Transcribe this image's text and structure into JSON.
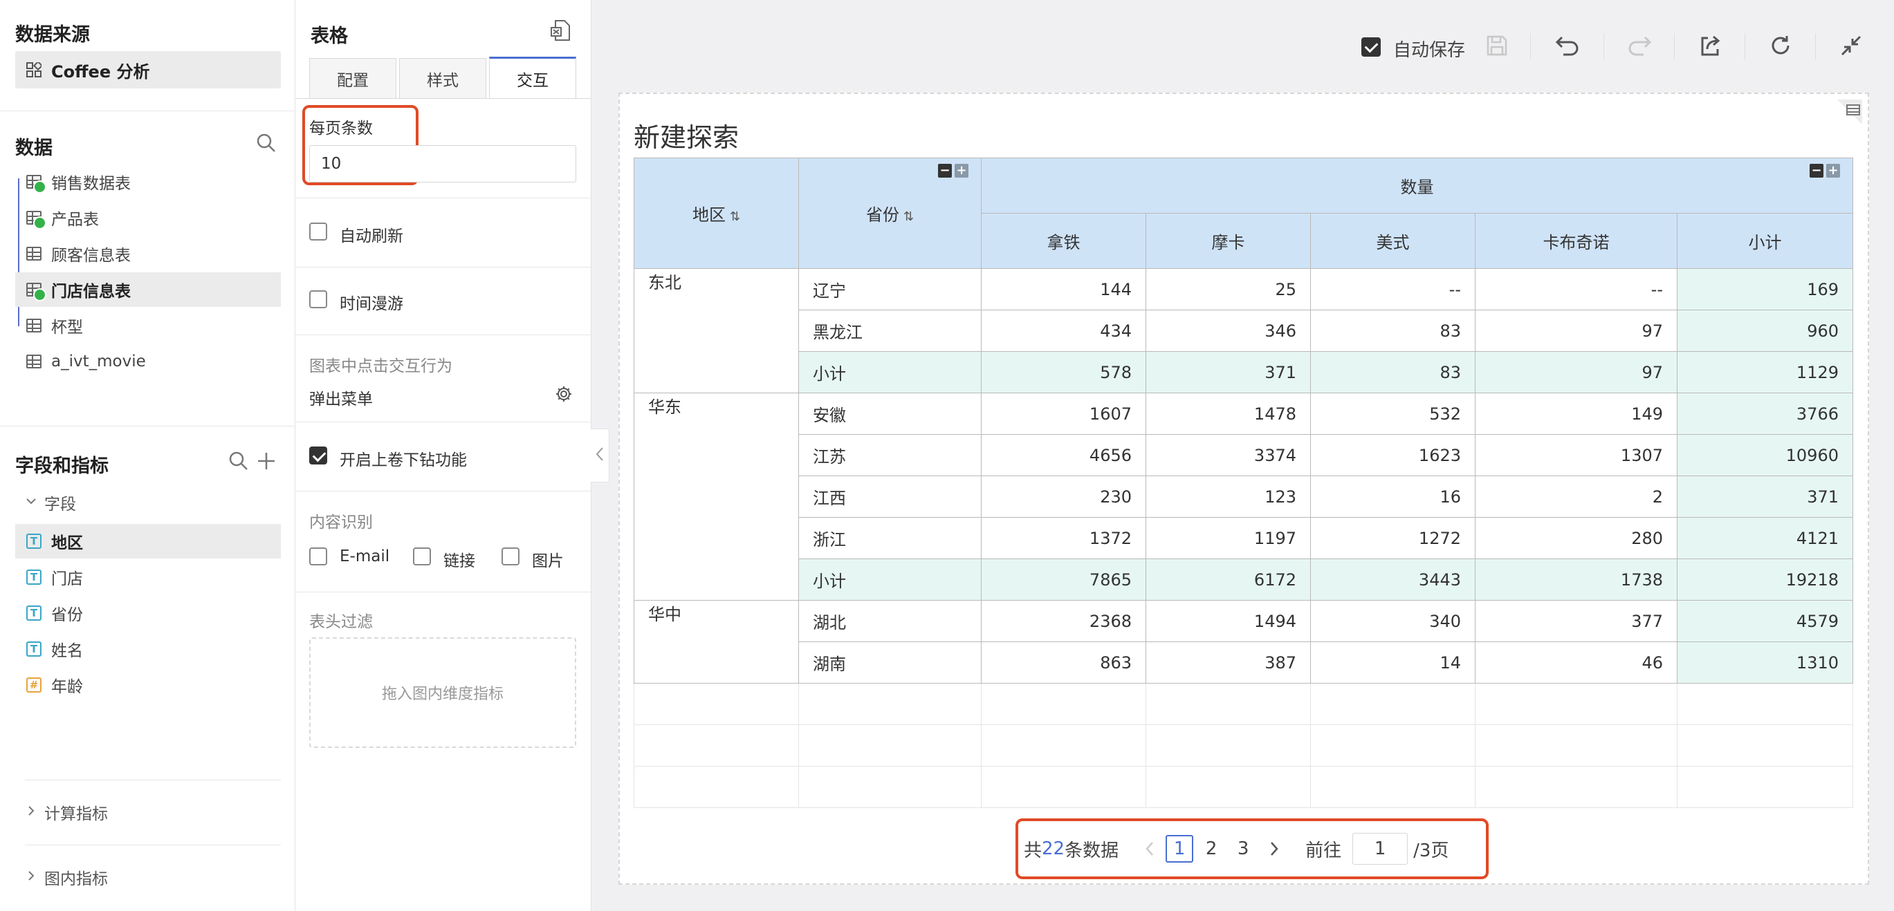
{
  "left": {
    "datasource_title": "数据来源",
    "datasource_name": "Coffee 分析",
    "data_title": "数据",
    "tables": [
      {
        "label": "销售数据表",
        "checked": true
      },
      {
        "label": "产品表",
        "checked": true
      },
      {
        "label": "顾客信息表",
        "checked": false
      },
      {
        "label": "门店信息表",
        "checked": true,
        "active": true
      },
      {
        "label": "杯型",
        "checked": false
      },
      {
        "label": "a_ivt_movie",
        "checked": false
      }
    ],
    "fields_title": "字段和指标",
    "fields_group": "字段",
    "fields": [
      {
        "label": "地区",
        "type": "T",
        "active": true
      },
      {
        "label": "门店",
        "type": "T"
      },
      {
        "label": "省份",
        "type": "T"
      },
      {
        "label": "姓名",
        "type": "T"
      },
      {
        "label": "年龄",
        "type": "#"
      }
    ],
    "calc_metrics": "计算指标",
    "inner_metrics": "图内指标"
  },
  "config": {
    "title": "表格",
    "tabs": [
      "配置",
      "样式",
      "交互"
    ],
    "active_tab": "交互",
    "page_size_label": "每页条数",
    "page_size_value": "10",
    "auto_refresh": "自动刷新",
    "time_roam": "时间漫游",
    "click_behavior_label": "图表中点击交互行为",
    "click_behavior_value": "弹出菜单",
    "drill_label": "开启上卷下钻功能",
    "content_recog_label": "内容识别",
    "recog_email": "E-mail",
    "recog_link": "链接",
    "recog_image": "图片",
    "header_filter_label": "表头过滤",
    "drop_hint": "拖入图内维度指标"
  },
  "toolbar": {
    "autosave_label": "自动保存",
    "autosave_checked": true
  },
  "chart": {
    "title": "新建探索",
    "header": {
      "region": "地区",
      "province": "省份",
      "measure": "数量",
      "columns": [
        "拿铁",
        "摩卡",
        "美式",
        "卡布奇诺",
        "小计"
      ]
    },
    "groups": [
      {
        "region": "东北",
        "rows": [
          {
            "province": "辽宁",
            "values": [
              "144",
              "25",
              "--",
              "--",
              "169"
            ],
            "subtotal": false
          },
          {
            "province": "黑龙江",
            "values": [
              "434",
              "346",
              "83",
              "97",
              "960"
            ],
            "subtotal": false
          },
          {
            "province": "小计",
            "values": [
              "578",
              "371",
              "83",
              "97",
              "1129"
            ],
            "subtotal": true
          }
        ]
      },
      {
        "region": "华东",
        "rows": [
          {
            "province": "安徽",
            "values": [
              "1607",
              "1478",
              "532",
              "149",
              "3766"
            ],
            "subtotal": false
          },
          {
            "province": "江苏",
            "values": [
              "4656",
              "3374",
              "1623",
              "1307",
              "10960"
            ],
            "subtotal": false
          },
          {
            "province": "江西",
            "values": [
              "230",
              "123",
              "16",
              "2",
              "371"
            ],
            "subtotal": false
          },
          {
            "province": "浙江",
            "values": [
              "1372",
              "1197",
              "1272",
              "280",
              "4121"
            ],
            "subtotal": false
          },
          {
            "province": "小计",
            "values": [
              "7865",
              "6172",
              "3443",
              "1738",
              "19218"
            ],
            "subtotal": true
          }
        ]
      },
      {
        "region": "华中",
        "rows": [
          {
            "province": "湖北",
            "values": [
              "2368",
              "1494",
              "340",
              "377",
              "4579"
            ],
            "subtotal": false
          },
          {
            "province": "湖南",
            "values": [
              "863",
              "387",
              "14",
              "46",
              "1310"
            ],
            "subtotal": false
          }
        ]
      }
    ],
    "empty_rows": 3
  },
  "pager": {
    "total_prefix": "共",
    "total_count": "22",
    "total_suffix": "条数据",
    "pages": [
      "1",
      "2",
      "3"
    ],
    "current": "1",
    "goto_label": "前往",
    "goto_value": "1",
    "page_total": "/3页"
  },
  "colors": {
    "accent": "#4a6fd1",
    "highlight_box": "#e04a26",
    "header_bg": "#cfe3f7",
    "subtotal_bg": "#e6f7f3",
    "check_green": "#34b24a"
  }
}
